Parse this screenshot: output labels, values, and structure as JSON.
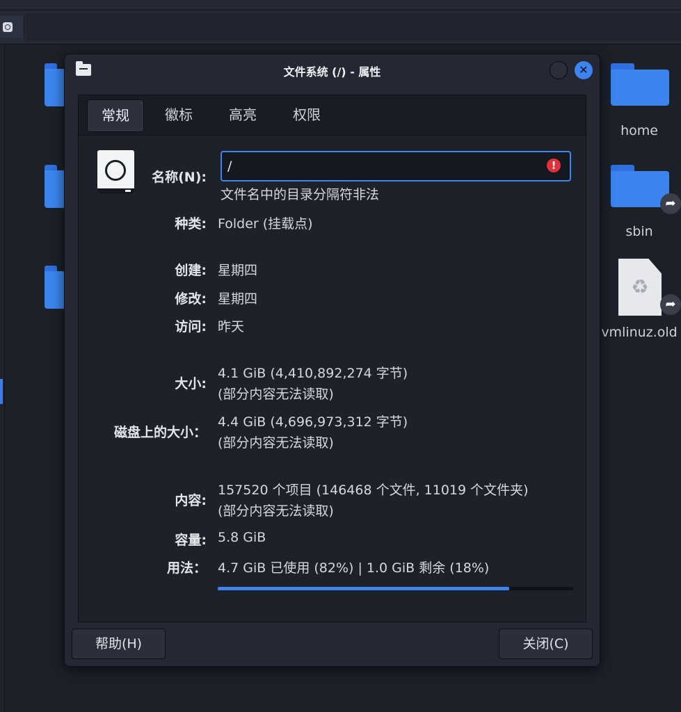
{
  "background": {
    "files": [
      {
        "label": "home"
      },
      {
        "label": "sbin"
      },
      {
        "label": "vmlinuz.old"
      }
    ],
    "link_glyph": "➦",
    "recycle_glyph": "♻"
  },
  "dialog": {
    "title": "文件系统 (/) - 属性",
    "close_glyph": "✕",
    "tabs": [
      {
        "label": "常规"
      },
      {
        "label": "徽标"
      },
      {
        "label": "高亮"
      },
      {
        "label": "权限"
      }
    ],
    "name": {
      "label": "名称(N):",
      "value": "/",
      "error_glyph": "!",
      "error_message": "文件名中的目录分隔符非法"
    },
    "type": {
      "label": "种类:",
      "value": "Folder (挂载点)"
    },
    "created": {
      "label": "创建:",
      "value": "星期四"
    },
    "modified": {
      "label": "修改:",
      "value": "星期四"
    },
    "accessed": {
      "label": "访问:",
      "value": "昨天"
    },
    "size": {
      "label": "大小:",
      "value": "4.1 GiB (4,410,892,274 字节)",
      "note": "(部分内容无法读取)"
    },
    "disk_size": {
      "label": "磁盘上的大小：",
      "value": "4.4 GiB (4,696,973,312 字节)",
      "note": "(部分内容无法读取)"
    },
    "contents": {
      "label": "内容:",
      "value": "157520 个项目 (146468 个文件, 11019 个文件夹)",
      "note": "(部分内容无法读取)"
    },
    "capacity": {
      "label": "容量:",
      "value": "5.8 GiB"
    },
    "usage": {
      "label": "用法：",
      "value": "4.7 GiB 已使用 (82%) | 1.0 GiB 剩余 (18%)",
      "used_percent": 82
    },
    "buttons": {
      "help": "帮助(H)",
      "close": "关闭(C)"
    },
    "colors": {
      "accent": "#3d84ef",
      "error": "#e0313b"
    }
  }
}
